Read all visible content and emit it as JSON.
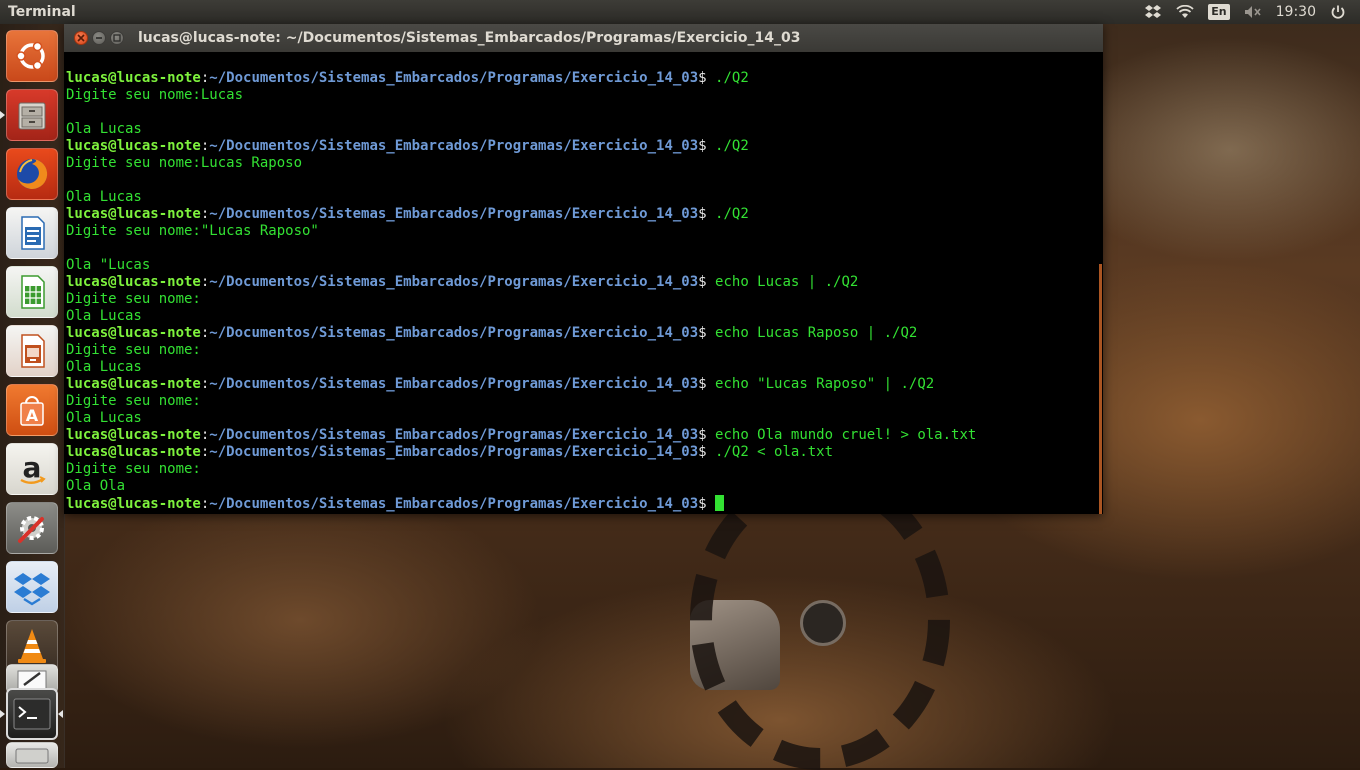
{
  "top_panel": {
    "app_title": "Terminal",
    "keyboard_layout": "En",
    "clock": "19:30",
    "indicators": [
      "dropbox-icon",
      "wifi-icon",
      "keyboard-layout",
      "volume-muted-icon",
      "clock",
      "power-icon"
    ]
  },
  "launcher": {
    "items": [
      {
        "name": "ubuntu-dash",
        "icon": "ubuntu-logo-icon",
        "color": "#e05a1b"
      },
      {
        "name": "files",
        "icon": "file-cabinet-icon",
        "color": "#b8b3aa"
      },
      {
        "name": "firefox",
        "icon": "firefox-icon",
        "color": "#e8761d"
      },
      {
        "name": "libreoffice-writer",
        "icon": "writer-document-icon",
        "color": "#2a6bb3"
      },
      {
        "name": "libreoffice-calc",
        "icon": "calc-spreadsheet-icon",
        "color": "#3b9b2f"
      },
      {
        "name": "libreoffice-impress",
        "icon": "impress-presentation-icon",
        "color": "#c0501e"
      },
      {
        "name": "ubuntu-software-center",
        "icon": "software-center-bag-icon",
        "color": "#e8641c"
      },
      {
        "name": "amazon",
        "icon": "amazon-logo-icon",
        "color": "#f0efe9"
      },
      {
        "name": "system-settings",
        "icon": "settings-wrench-icon",
        "color": "#888884"
      },
      {
        "name": "dropbox",
        "icon": "dropbox-box-icon",
        "color": "#2b7cd3"
      },
      {
        "name": "vlc",
        "icon": "vlc-cone-icon",
        "color": "#f08a14"
      },
      {
        "name": "text-editor",
        "icon": "text-editor-pencil-icon",
        "color": "#cfcfcf"
      },
      {
        "name": "terminal",
        "icon": "terminal-prompt-icon",
        "color": "#2f2f2f"
      },
      {
        "name": "trash",
        "icon": "drive-icon",
        "color": "#cfcfcf"
      }
    ]
  },
  "window": {
    "title": "lucas@lucas-note: ~/Documentos/Sistemas_Embarcados/Programas/Exercicio_14_03",
    "accent_close": "#e55b28"
  },
  "terminal": {
    "prompt_user": "lucas@lucas-note",
    "prompt_colon": ":",
    "prompt_path": "~/Documentos/Sistemas_Embarcados/Programas/Exercicio_14_03",
    "prompt_dollar": "$ ",
    "lines": [
      {
        "prompt": true,
        "cmd": "./Q2"
      },
      {
        "prompt": false,
        "text": "Digite seu nome:Lucas"
      },
      {
        "prompt": false,
        "text": ""
      },
      {
        "prompt": false,
        "text": "Ola Lucas"
      },
      {
        "prompt": true,
        "cmd": "./Q2"
      },
      {
        "prompt": false,
        "text": "Digite seu nome:Lucas Raposo"
      },
      {
        "prompt": false,
        "text": ""
      },
      {
        "prompt": false,
        "text": "Ola Lucas"
      },
      {
        "prompt": true,
        "cmd": "./Q2"
      },
      {
        "prompt": false,
        "text": "Digite seu nome:\"Lucas Raposo\""
      },
      {
        "prompt": false,
        "text": ""
      },
      {
        "prompt": false,
        "text": "Ola \"Lucas"
      },
      {
        "prompt": true,
        "cmd": "echo Lucas | ./Q2"
      },
      {
        "prompt": false,
        "text": "Digite seu nome:"
      },
      {
        "prompt": false,
        "text": "Ola Lucas"
      },
      {
        "prompt": true,
        "cmd": "echo Lucas Raposo | ./Q2"
      },
      {
        "prompt": false,
        "text": "Digite seu nome:"
      },
      {
        "prompt": false,
        "text": "Ola Lucas"
      },
      {
        "prompt": true,
        "cmd": "echo \"Lucas Raposo\" | ./Q2"
      },
      {
        "prompt": false,
        "text": "Digite seu nome:"
      },
      {
        "prompt": false,
        "text": "Ola Lucas"
      },
      {
        "prompt": true,
        "cmd": "echo Ola mundo cruel! > ola.txt"
      },
      {
        "prompt": true,
        "cmd": "./Q2 < ola.txt"
      },
      {
        "prompt": false,
        "text": "Digite seu nome:"
      },
      {
        "prompt": false,
        "text": "Ola Ola"
      },
      {
        "prompt": true,
        "cmd": "",
        "cursor": true
      }
    ],
    "colors": {
      "user": "#7ef23d",
      "path": "#6f9ad6",
      "output": "#33e133"
    }
  }
}
